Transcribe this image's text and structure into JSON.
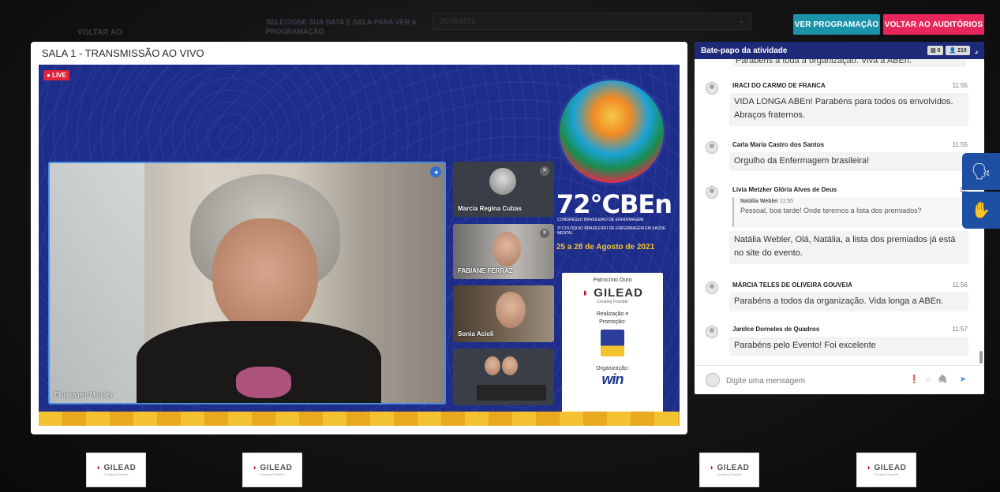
{
  "background_header": {
    "back_label": "VOLTAR AO",
    "select_label": "SELECIONE SUA DATA E SALA PARA VER A PROGRAMAÇÃO",
    "date_value": "25/08/2021",
    "date_caret": "⌄"
  },
  "top_buttons": {
    "programacao": "VER PROGRAMAÇÃO",
    "voltar": "VOLTAR AO AUDITÓRIOS"
  },
  "video_panel": {
    "title": "SALA 1 - TRANSMISSÃO AO VIVO",
    "live_label": "● LIVE",
    "main_speaker": "Elucaragem Mendes",
    "participants": [
      {
        "name": "Marcia Regina Cubas"
      },
      {
        "name": "FABIANE FERRAZ"
      },
      {
        "name": "Sonia Acioli"
      }
    ],
    "event": {
      "number": "72°CBEn",
      "subtitle1": "CONGRESSO BRASILEIRO DE ENFERMAGEM",
      "subtitle2": "3º COLÓQUIO BRASILEIRO DE ENFERMAGEM EM SAÚDE MENTAL",
      "dates": "25 a 28 de Agosto de 2021"
    },
    "sponsor_box": {
      "patrocinio": "Patrocínio Ouro",
      "gilead": "GILEAD",
      "gilead_tagline": "Creating Possible",
      "realizacao": "Realização e Promoção:",
      "organizacao": "Organização:",
      "win": "win"
    }
  },
  "chat": {
    "header": "Bate-papo da atividade",
    "badge_messages": "▤ 0",
    "badge_users": "👤 219",
    "partial_message": "Parabéns a toda a organização. Viva a ABEn.",
    "messages": [
      {
        "name": "IRACI DO CARMO DE FRANCA",
        "time": "11:55",
        "text": "VIDA LONGA ABEn! Parabéns para todos os envolvidos. Abraços fraternos."
      },
      {
        "name": "Carla Maria Castro dos Santos",
        "time": "11:55",
        "text": "Orgulho da Enfermagem brasileira!"
      },
      {
        "name": "Livia Metzker Glória Alves de Deus",
        "time": "11:",
        "text": "Natália Webler, Olá, Natália, a lista dos premiados já está no site do evento.",
        "quote_name": "Natália Webler",
        "quote_time": "11:55",
        "quote_text": "Pessoal, boa tarde! Onde teremos a lista dos premiados?"
      },
      {
        "name": "MÁRCIA TELES DE OLIVEIRA GOUVEIA",
        "time": "11:56",
        "text": "Parabéns a todos da organização. Vida longa a ABEn."
      },
      {
        "name": "Janilce Dorneles de Quadros",
        "time": "11:57",
        "text": "Parabéns pelo Evento! Foi excelente"
      }
    ],
    "input_placeholder": "Digite uma mensagem",
    "icons": {
      "info": "❗",
      "emoji": "☺",
      "attach": "🖇",
      "send": "➤"
    }
  },
  "accessibility": {
    "audio_icon": "🗣",
    "sign_icon": "✋"
  },
  "footer_sponsors": [
    {
      "word": "GILEAD",
      "tag": "Creating Possible"
    },
    {
      "word": "GILEAD",
      "tag": "Creating Possible"
    },
    {
      "word": "GILEAD",
      "tag": "Creating Possible"
    },
    {
      "word": "GILEAD",
      "tag": "Creating Possible"
    }
  ]
}
